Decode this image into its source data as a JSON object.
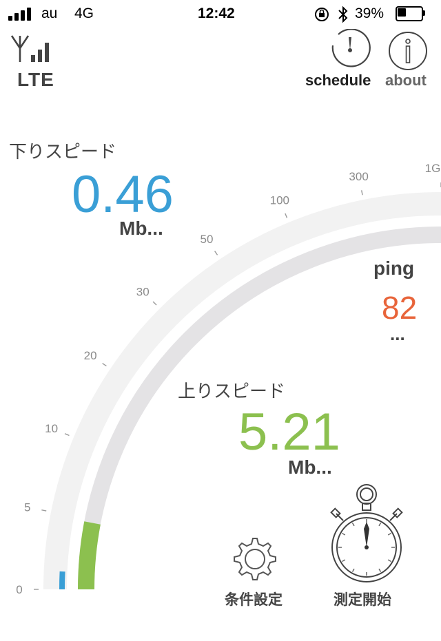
{
  "status_bar": {
    "carrier": "au",
    "network": "4G",
    "time": "12:42",
    "battery_percent": "39%",
    "battery_level": 0.39
  },
  "header": {
    "connection_type": "LTE",
    "schedule_label": "schedule",
    "about_label": "about"
  },
  "download": {
    "label": "下りスピード",
    "value": "0.46",
    "unit": "Mb...",
    "color": "#3a9fd6"
  },
  "upload": {
    "label": "上りスピード",
    "value": "5.21",
    "unit": "Mb...",
    "color": "#8cc04f"
  },
  "ping": {
    "label": "ping",
    "value": "82",
    "unit": "...",
    "color": "#e8643a"
  },
  "gauge": {
    "tick_labels": [
      "0",
      "5",
      "10",
      "20",
      "30",
      "50",
      "100",
      "300",
      "1G"
    ],
    "download_fraction": 0.03,
    "upload_fraction": 0.12,
    "track_color": "#f2f2f2",
    "inner_track_color": "#e4e3e5"
  },
  "bottom_bar": {
    "settings_label": "条件設定",
    "start_label": "測定開始"
  }
}
